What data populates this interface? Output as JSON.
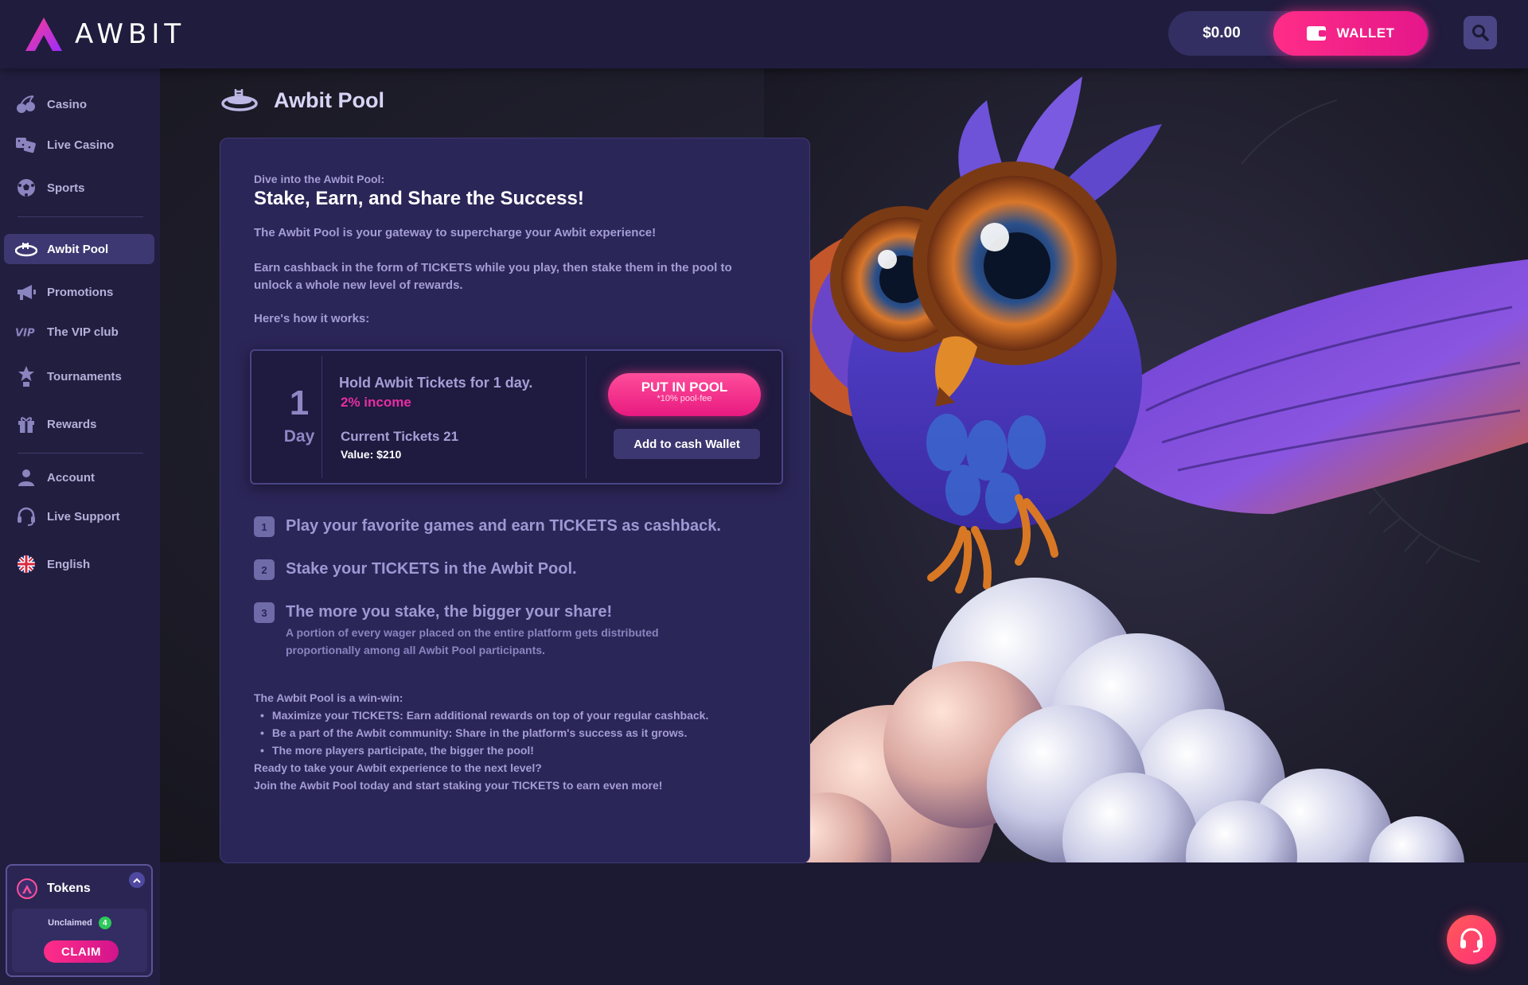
{
  "brand": {
    "name": "AWBIT"
  },
  "header": {
    "balance": "$0.00",
    "wallet_label": "WALLET"
  },
  "sidebar": {
    "items": [
      {
        "label": "Casino",
        "icon": "cherries-icon"
      },
      {
        "label": "Live Casino",
        "icon": "dice-icon"
      },
      {
        "label": "Sports",
        "icon": "soccer-ball-icon"
      },
      {
        "label": "Awbit Pool",
        "icon": "pool-icon",
        "active": true
      },
      {
        "label": "Promotions",
        "icon": "megaphone-icon"
      },
      {
        "label": "The VIP club",
        "icon": "vip-icon"
      },
      {
        "label": "Tournaments",
        "icon": "trophy-icon"
      },
      {
        "label": "Rewards",
        "icon": "gift-icon"
      },
      {
        "label": "Account",
        "icon": "user-icon"
      },
      {
        "label": "Live Support",
        "icon": "headset-icon"
      },
      {
        "label": "English",
        "icon": "uk-flag-icon"
      }
    ],
    "tokens": {
      "title": "Tokens",
      "unclaimed_label": "Unclaimed",
      "unclaimed_count": "4",
      "claim_label": "CLAIM"
    }
  },
  "page": {
    "title": "Awbit Pool",
    "intro_kicker": "Dive into the Awbit Pool:",
    "heading": "Stake, Earn, and Share the Success!",
    "para1": "The Awbit Pool is your gateway to supercharge your Awbit experience!",
    "para2_line1": "Earn cashback in the form of TICKETS while you play, then stake them in the pool to",
    "para2_line2": "unlock a whole new level of rewards.",
    "how_it_works": "Here's how it works:",
    "pool": {
      "day_number": "1",
      "day_label": "Day",
      "hold_text": "Hold Awbit Tickets for 1 day.",
      "income": "2% income",
      "current_tickets": "Current Tickets 21",
      "value": "Value: $210",
      "put_label": "PUT IN POOL",
      "put_fee": "*10% pool-fee",
      "add_cash_label": "Add to cash Wallet"
    },
    "steps": [
      {
        "num": "1",
        "title": "Play your favorite games and earn TICKETS as cashback."
      },
      {
        "num": "2",
        "title": "Stake your TICKETS in the Awbit Pool."
      },
      {
        "num": "3",
        "title": "The more you stake, the bigger your share!",
        "sub_line1": "A portion of every wager placed on the entire platform gets distributed",
        "sub_line2": "proportionally among all Awbit Pool participants."
      }
    ],
    "winwin_title": "The Awbit Pool is a win-win:",
    "winwin": [
      "Maximize your TICKETS: Earn additional rewards on top of your regular cashback.",
      "Be a part of the Awbit community: Share in the platform's success as it grows.",
      "The more players participate, the bigger the pool!"
    ],
    "cta_line1": "Ready to take your Awbit experience to the next level?",
    "cta_line2": "Join the Awbit Pool today and start staking your TICKETS to earn even more!"
  },
  "colors": {
    "accent": "#ff2d88",
    "background": "#1c1933",
    "panel": "#2b2658",
    "text_muted": "#a49dd6"
  }
}
